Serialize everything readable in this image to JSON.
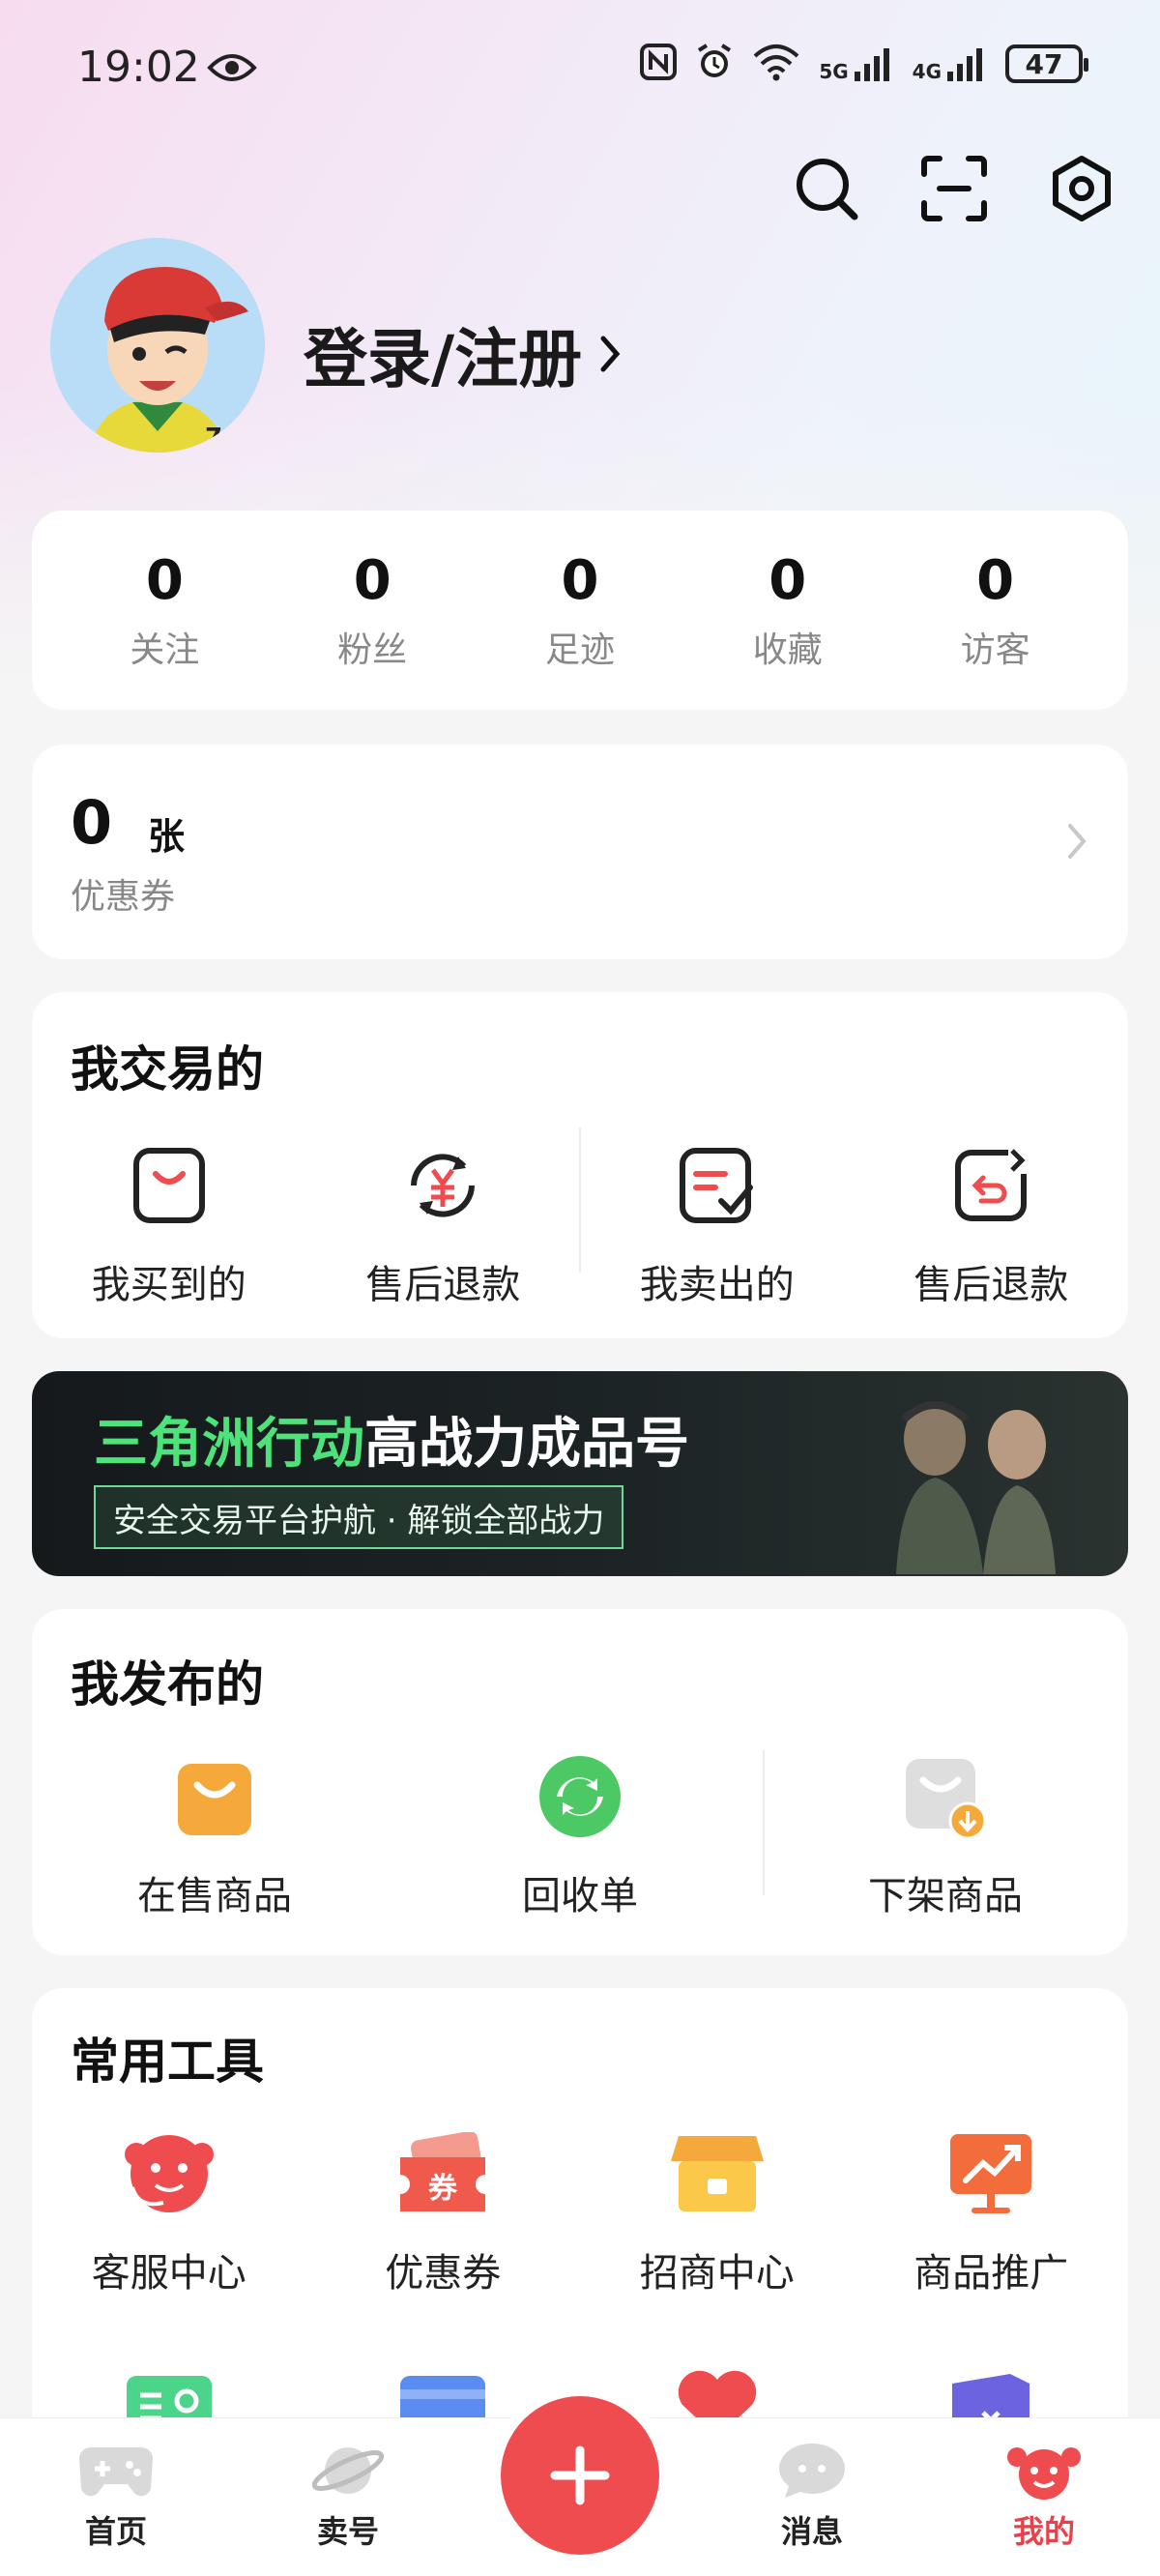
{
  "status_bar": {
    "time": "19:02",
    "battery": "47",
    "signal_1": "5G",
    "signal_2": "4G"
  },
  "profile": {
    "login_label": "登录/注册"
  },
  "stats": [
    {
      "value": "0",
      "label": "关注"
    },
    {
      "value": "0",
      "label": "粉丝"
    },
    {
      "value": "0",
      "label": "足迹"
    },
    {
      "value": "0",
      "label": "收藏"
    },
    {
      "value": "0",
      "label": "访客"
    }
  ],
  "coupon": {
    "count": "0",
    "unit": "张",
    "label": "优惠券"
  },
  "trade": {
    "title": "我交易的",
    "items": [
      {
        "label": "我买到的",
        "icon": "bag-icon"
      },
      {
        "label": "售后退款",
        "icon": "yuan-refresh-icon"
      },
      {
        "label": "我卖出的",
        "icon": "list-check-icon"
      },
      {
        "label": "售后退款",
        "icon": "return-arrow-icon"
      }
    ]
  },
  "banner": {
    "title_green": "三角洲行动",
    "title_white": "高战力成品号",
    "subtitle": "安全交易平台护航 · 解锁全部战力"
  },
  "publish": {
    "title": "我发布的",
    "items": [
      {
        "label": "在售商品",
        "icon": "shopping-bag-icon"
      },
      {
        "label": "回收单",
        "icon": "recycle-icon"
      },
      {
        "label": "下架商品",
        "icon": "delist-bag-icon"
      }
    ]
  },
  "tools": {
    "title": "常用工具",
    "items": [
      {
        "label": "客服中心",
        "icon": "customer-service-icon"
      },
      {
        "label": "优惠券",
        "icon": "coupon-icon"
      },
      {
        "label": "招商中心",
        "icon": "store-icon"
      },
      {
        "label": "商品推广",
        "icon": "promotion-icon"
      }
    ],
    "row2_icons": [
      "contact-card-icon",
      "card-icon",
      "heart-icon",
      "ticket-icon"
    ]
  },
  "tabbar": [
    {
      "label": "首页",
      "icon": "gamepad-icon"
    },
    {
      "label": "卖号",
      "icon": "planet-icon"
    },
    {
      "label": "",
      "icon": "plus-icon"
    },
    {
      "label": "消息",
      "icon": "chat-icon"
    },
    {
      "label": "我的",
      "icon": "mascot-icon",
      "active": true
    }
  ],
  "colors": {
    "accent": "#ef4c4f",
    "banner_green": "#4ee27a",
    "orange": "#f5a93b",
    "green": "#4cc964"
  }
}
